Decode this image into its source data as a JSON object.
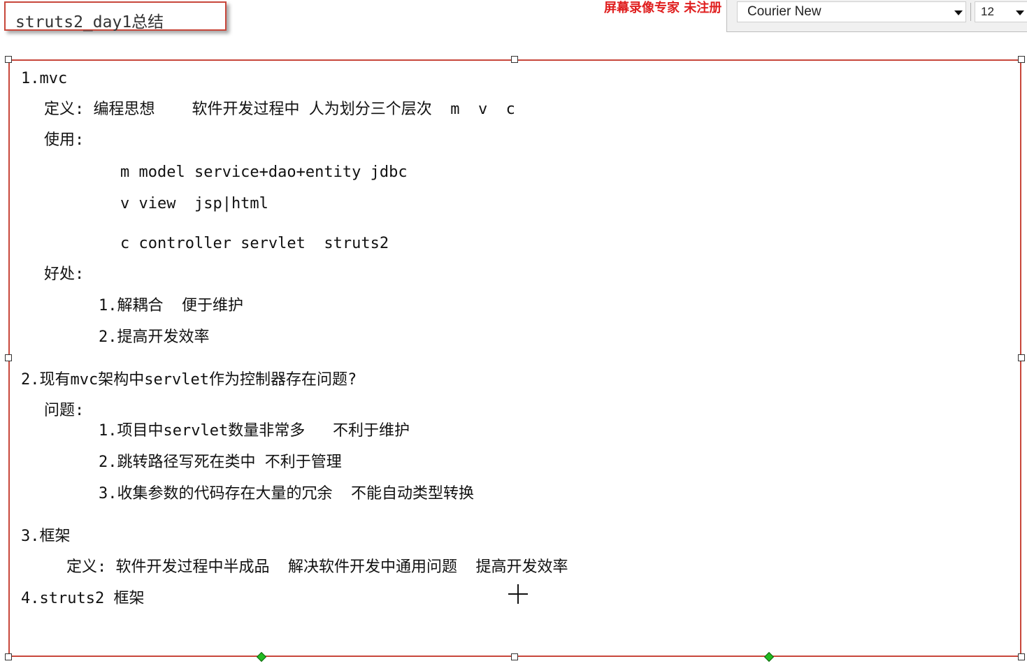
{
  "title": "struts2_day1总结",
  "watermark": "屏幕录像专家 未注册",
  "toolbar": {
    "font_family": "Courier New",
    "font_size": "12",
    "caret_icon": "chevron-down-icon"
  },
  "content": {
    "lines": [
      "1.mvc",
      "定义: 编程思想    软件开发过程中 人为划分三个层次  m  v  c",
      "使用:",
      "m model service+dao+entity jdbc",
      "v view  jsp|html",
      "c controller servlet  struts2",
      "好处:",
      "1.解耦合  便于维护",
      "2.提高开发效率",
      "2.现有mvc架构中servlet作为控制器存在问题?",
      "问题:",
      "1.项目中servlet数量非常多   不利于维护",
      "2.跳转路径写死在类中 不利于管理",
      "3.收集参数的代码存在大量的冗余  不能自动类型转换",
      "3.框架",
      "定义: 软件开发过程中半成品  解决软件开发中通用问题  提高开发效率",
      "4.struts2 框架"
    ]
  },
  "colors": {
    "border": "#c8473b",
    "watermark": "#e02020",
    "handle_green": "#22bb22"
  }
}
